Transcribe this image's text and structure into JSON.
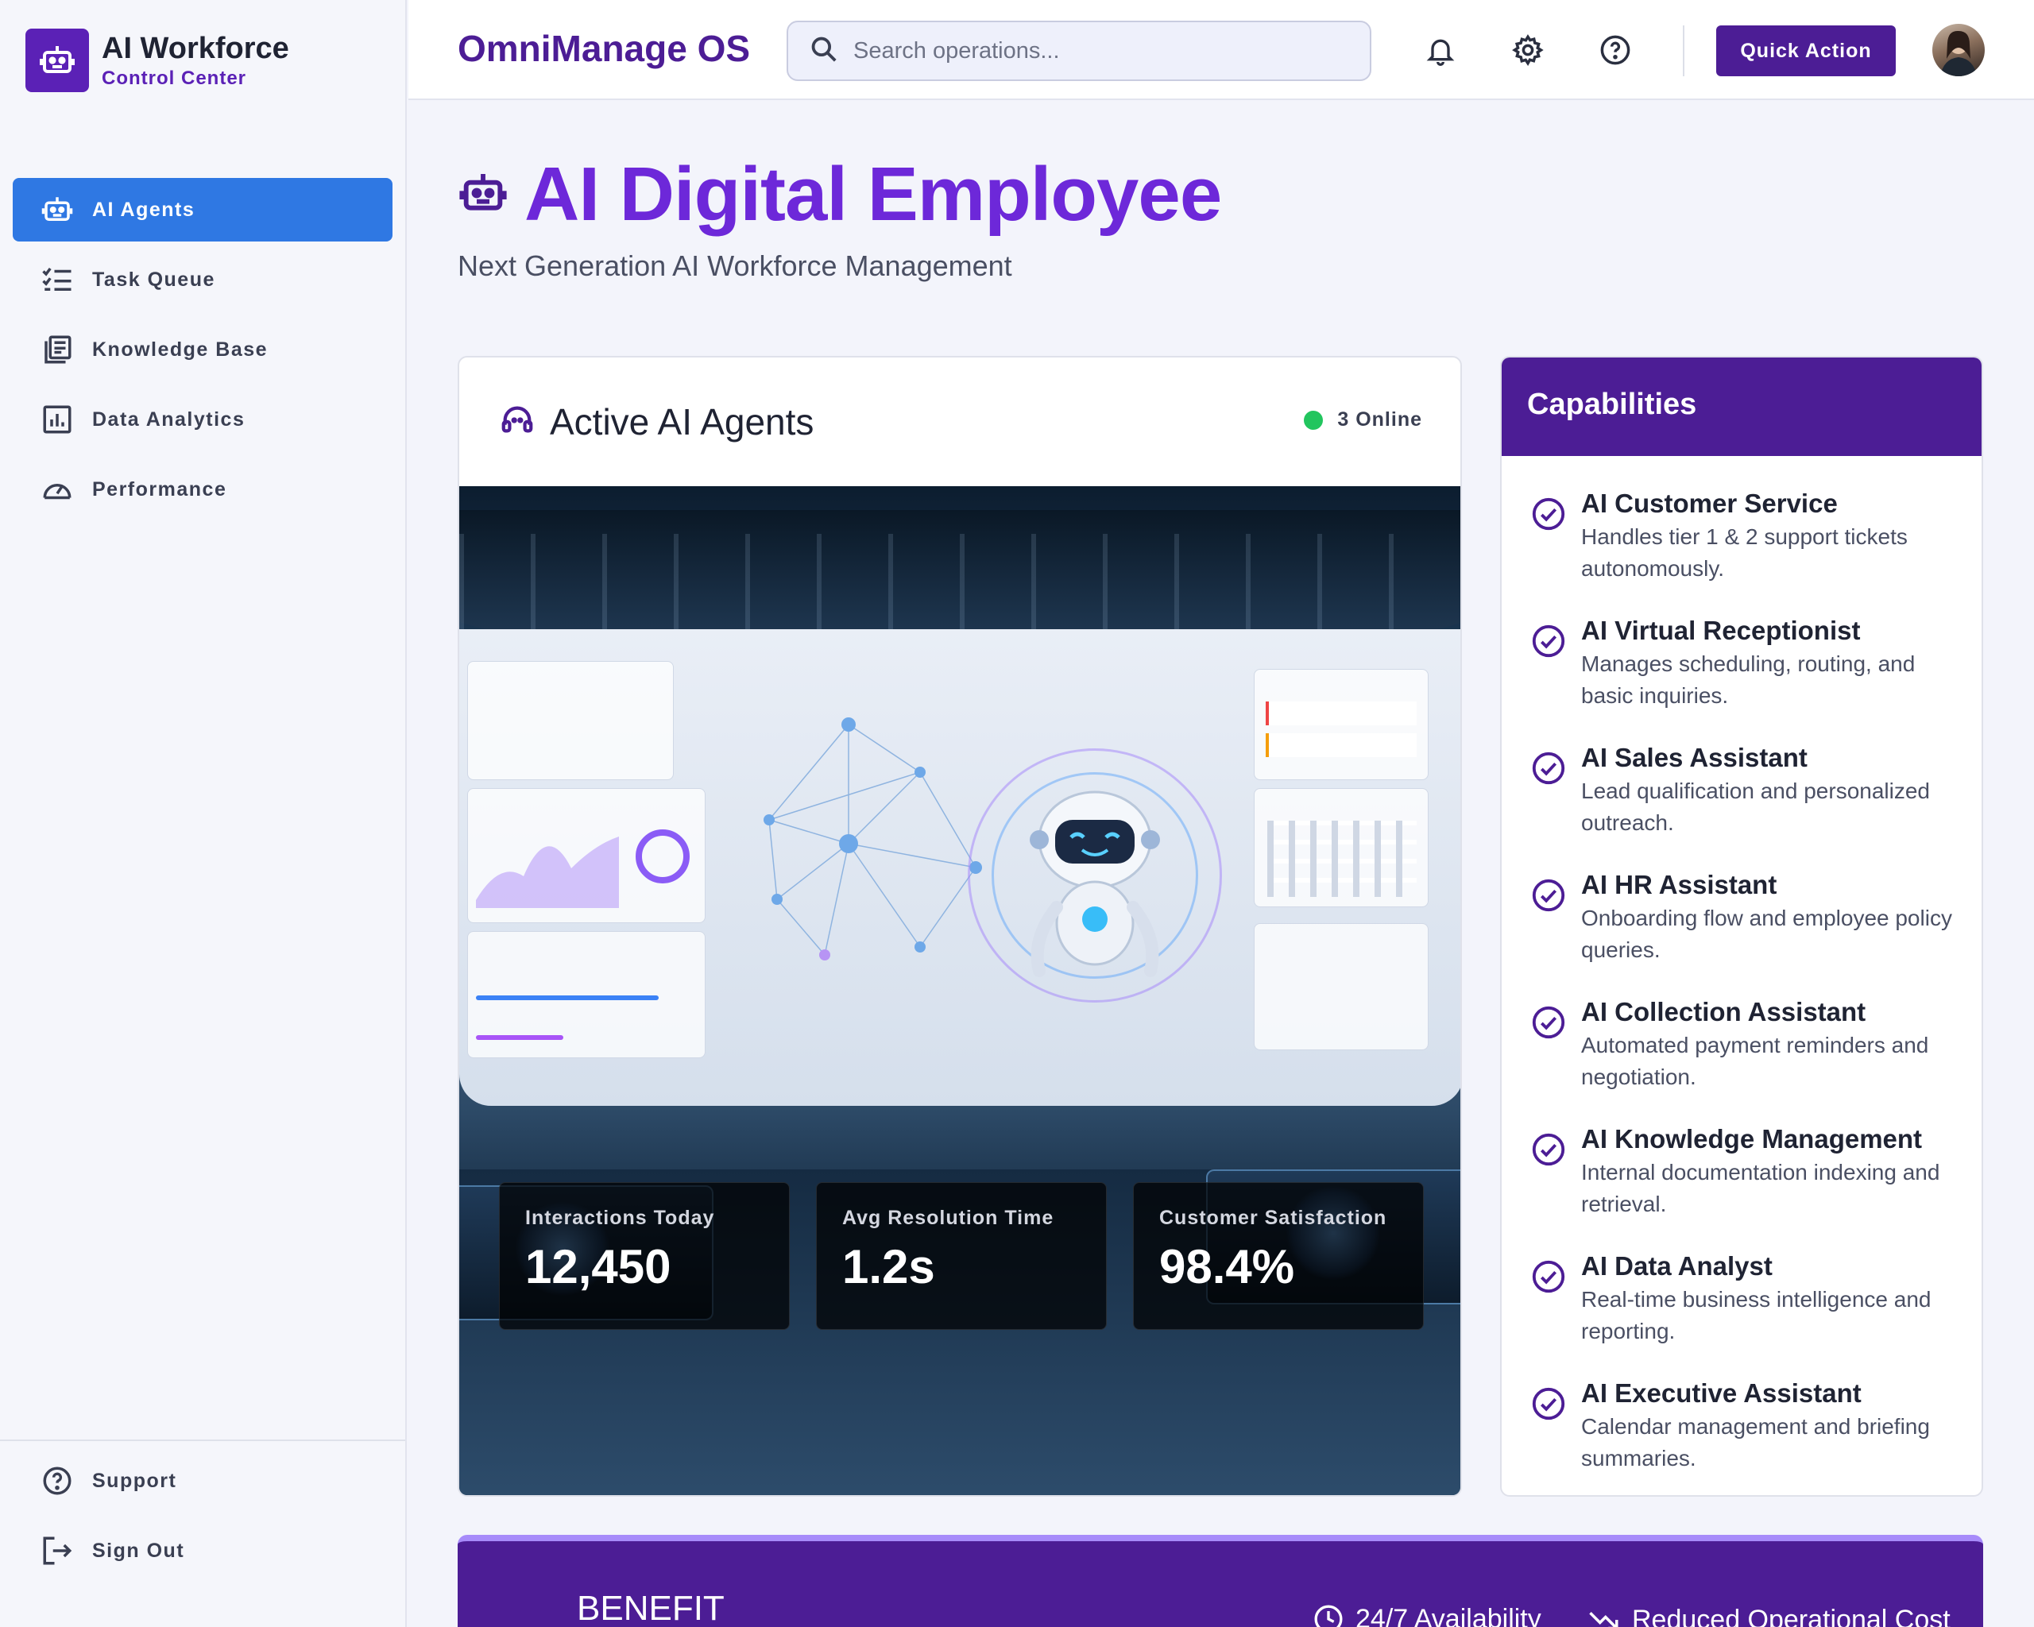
{
  "sidebar": {
    "brand_title": "AI Workforce",
    "brand_subtitle": "Control Center",
    "items": [
      {
        "label": "AI Agents",
        "icon": "robot-icon",
        "active": true
      },
      {
        "label": "Task Queue",
        "icon": "checklist-icon",
        "active": false
      },
      {
        "label": "Knowledge Base",
        "icon": "library-icon",
        "active": false
      },
      {
        "label": "Data Analytics",
        "icon": "chart-icon",
        "active": false
      },
      {
        "label": "Performance",
        "icon": "speedometer-icon",
        "active": false
      }
    ],
    "footer": [
      {
        "label": "Support",
        "icon": "help-icon"
      },
      {
        "label": "Sign Out",
        "icon": "logout-icon"
      }
    ]
  },
  "header": {
    "app_name": "OmniManage OS",
    "search_placeholder": "Search operations...",
    "quick_action_label": "Quick Action",
    "icons": [
      "bell-icon",
      "gear-icon",
      "help-icon"
    ]
  },
  "hero": {
    "title": "AI Digital Employee",
    "subtitle": "Next Generation AI Workforce Management"
  },
  "agents_card": {
    "title": "Active AI Agents",
    "online_status": "3 Online",
    "stats": [
      {
        "label": "Interactions Today",
        "value": "12,450"
      },
      {
        "label": "Avg Resolution Time",
        "value": "1.2s"
      },
      {
        "label": "Customer Satisfaction",
        "value": "98.4%"
      }
    ]
  },
  "capabilities": {
    "title": "Capabilities",
    "items": [
      {
        "title": "AI Customer Service",
        "desc": "Handles tier 1 & 2 support tickets autonomously."
      },
      {
        "title": "AI Virtual Receptionist",
        "desc": "Manages scheduling, routing, and basic inquiries."
      },
      {
        "title": "AI Sales Assistant",
        "desc": "Lead qualification and personalized outreach."
      },
      {
        "title": "AI HR Assistant",
        "desc": "Onboarding flow and employee policy queries."
      },
      {
        "title": "AI Collection Assistant",
        "desc": "Automated payment reminders and negotiation."
      },
      {
        "title": "AI Knowledge Management",
        "desc": "Internal documentation indexing and retrieval."
      },
      {
        "title": "AI Data Analyst",
        "desc": "Real-time business intelligence and reporting."
      },
      {
        "title": "AI Executive Assistant",
        "desc": "Calendar management and briefing summaries."
      }
    ]
  },
  "benefit": {
    "title": "BENEFIT",
    "items": [
      "24/7 Availability",
      "Reduced Operational Cost"
    ]
  },
  "colors": {
    "brand": "#4c1d95",
    "accent": "#6d28d9",
    "active_nav": "#2f78e3",
    "online": "#22c55e"
  }
}
